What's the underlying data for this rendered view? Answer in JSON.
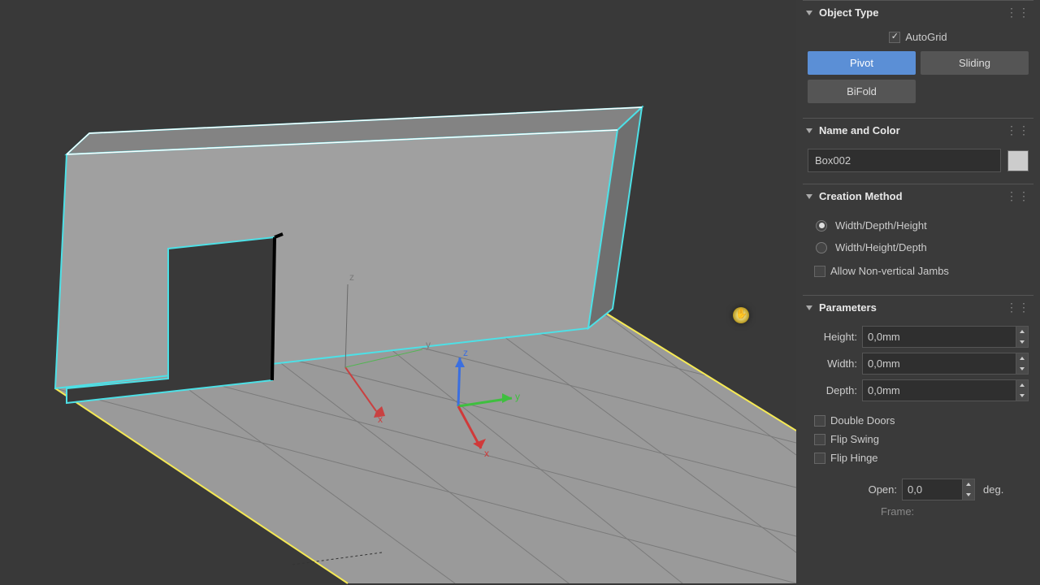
{
  "object_type": {
    "title": "Object Type",
    "autogrid": {
      "label": "AutoGrid",
      "checked": true
    },
    "buttons": {
      "pivot": "Pivot",
      "sliding": "Sliding",
      "bifold": "BiFold"
    },
    "active": "pivot"
  },
  "name_color": {
    "title": "Name and Color",
    "name": "Box002"
  },
  "creation": {
    "title": "Creation Method",
    "options": {
      "wdh": "Width/Depth/Height",
      "whd": "Width/Height/Depth"
    },
    "selected": "wdh",
    "allow_jambs": {
      "label": "Allow Non-vertical Jambs",
      "checked": false
    }
  },
  "parameters": {
    "title": "Parameters",
    "height": {
      "label": "Height:",
      "value": "0,0mm"
    },
    "width": {
      "label": "Width:",
      "value": "0,0mm"
    },
    "depth": {
      "label": "Depth:",
      "value": "0,0mm"
    },
    "double_doors": {
      "label": "Double Doors",
      "checked": false
    },
    "flip_swing": {
      "label": "Flip Swing",
      "checked": false
    },
    "flip_hinge": {
      "label": "Flip Hinge",
      "checked": false
    },
    "open": {
      "label": "Open:",
      "value": "0,0",
      "unit": "deg."
    },
    "frame": "Frame:"
  },
  "axes": {
    "x": "x",
    "y": "y",
    "z": "z"
  }
}
